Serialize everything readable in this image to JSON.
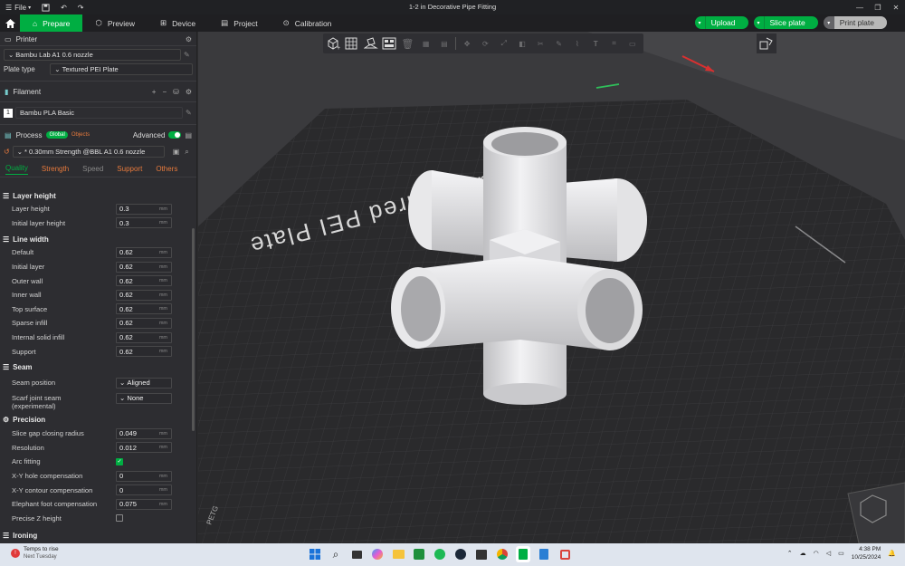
{
  "titlebar": {
    "menu_label": "File",
    "title": "1-2 in Decorative Pipe Fitting"
  },
  "nav": {
    "tabs": [
      {
        "label": "Prepare",
        "active": true
      },
      {
        "label": "Preview"
      },
      {
        "label": "Device"
      },
      {
        "label": "Project"
      },
      {
        "label": "Calibration"
      }
    ],
    "upload_label": "Upload",
    "slice_label": "Slice plate",
    "print_label": "Print plate"
  },
  "printer": {
    "section_label": "Printer",
    "name": "Bambu Lab A1 0.6 nozzle",
    "plate_type_label": "Plate type",
    "plate_type_value": "Textured PEI Plate"
  },
  "filament": {
    "section_label": "Filament",
    "slot": "1",
    "name": "Bambu PLA Basic"
  },
  "process": {
    "section_label": "Process",
    "global_badge": "Global",
    "objects_badge": "Objects",
    "advanced_label": "Advanced",
    "preset": "* 0.30mm Strength @BBL A1 0.6 nozzle",
    "tabs": [
      "Quality",
      "Strength",
      "Speed",
      "Support",
      "Others"
    ]
  },
  "groups": {
    "layer_height": "Layer height",
    "line_width": "Line width",
    "seam": "Seam",
    "precision": "Precision",
    "ironing": "Ironing"
  },
  "unit_mm": "mm",
  "settings": {
    "layer_height": "Layer height",
    "layer_height_val": "0.3",
    "initial_layer_height": "Initial layer height",
    "initial_layer_height_val": "0.3",
    "lw_default": "Default",
    "lw_default_val": "0.62",
    "lw_initial": "Initial layer",
    "lw_initial_val": "0.62",
    "lw_outer": "Outer wall",
    "lw_outer_val": "0.62",
    "lw_inner": "Inner wall",
    "lw_inner_val": "0.62",
    "lw_top": "Top surface",
    "lw_top_val": "0.62",
    "lw_sparse": "Sparse infill",
    "lw_sparse_val": "0.62",
    "lw_internal": "Internal solid infill",
    "lw_internal_val": "0.62",
    "lw_support": "Support",
    "lw_support_val": "0.62",
    "seam_position": "Seam position",
    "seam_position_val": "Aligned",
    "scarf_joint": "Scarf joint seam",
    "scarf_joint_sub": "(experimental)",
    "scarf_joint_val": "None",
    "slice_gap": "Slice gap closing radius",
    "slice_gap_val": "0.049",
    "resolution": "Resolution",
    "resolution_val": "0.012",
    "arc_fitting": "Arc fitting",
    "arc_fitting_checked": true,
    "xy_hole": "X-Y hole compensation",
    "xy_hole_val": "0",
    "xy_contour": "X-Y contour compensation",
    "xy_contour_val": "0",
    "elephant_foot": "Elephant foot compensation",
    "elephant_foot_val": "0.075",
    "precise_z": "Precise Z height",
    "precise_z_checked": false
  },
  "plate": {
    "label": "Bambu Textured PEI Plate",
    "corner_label": "PETG"
  },
  "taskbar": {
    "weather_title": "Temps to rise",
    "weather_sub": "Next Tuesday",
    "time": "4:38 PM",
    "date": "10/25/2024"
  },
  "colors": {
    "accent": "#00ae42",
    "sidebar_bg": "#2d2d31",
    "viewport_bg": "#3a3a3d",
    "plate": "#2a2a2c",
    "model": "#e6e6e8",
    "orange_tab": "#e87a3c"
  }
}
